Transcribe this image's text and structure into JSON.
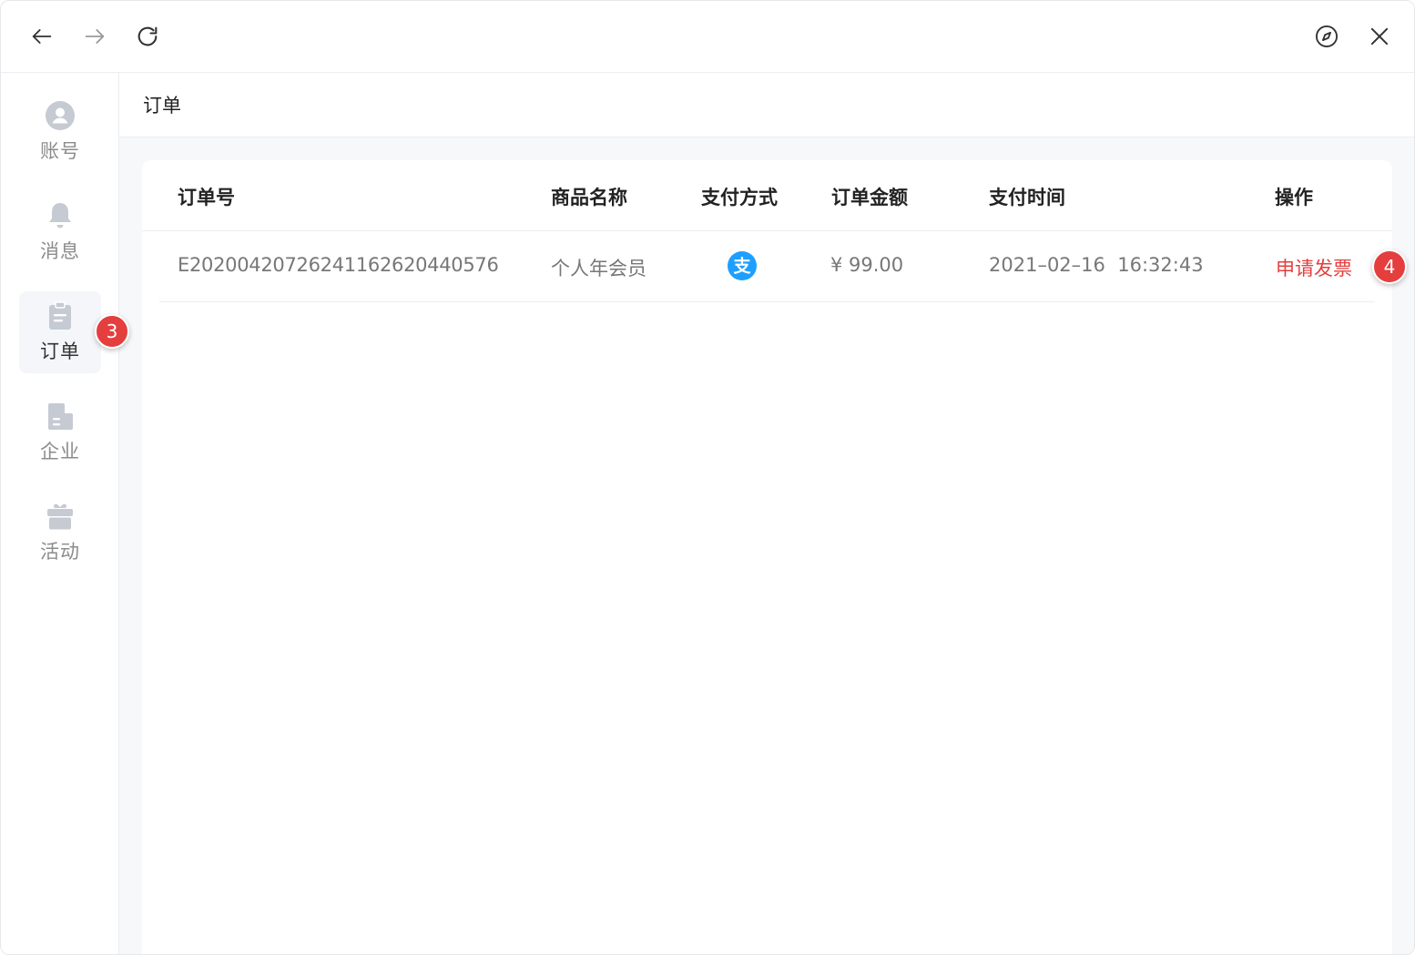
{
  "titlebar": {
    "icons": [
      "arrow-left-icon",
      "arrow-right-icon",
      "refresh-icon",
      "compass-icon",
      "close-icon"
    ]
  },
  "sidebar": {
    "items": [
      {
        "label": "账号",
        "icon": "user-icon"
      },
      {
        "label": "消息",
        "icon": "bell-icon"
      },
      {
        "label": "订单",
        "icon": "clipboard-icon"
      },
      {
        "label": "企业",
        "icon": "building-icon"
      },
      {
        "label": "活动",
        "icon": "gift-icon"
      }
    ]
  },
  "badges": {
    "orders": "3",
    "invoice": "4"
  },
  "page": {
    "title": "订单"
  },
  "table": {
    "headers": [
      "订单号",
      "商品名称",
      "支付方式",
      "订单金额",
      "支付时间",
      "操作"
    ],
    "rows": [
      {
        "order_no": "E20200420726241162620440576",
        "product": "个人年会员",
        "payment_icon": "alipay-icon",
        "payment_glyph": "支",
        "amount": "¥ 99.00",
        "paid_at": "2021–02–16  16:32:43",
        "action": "申请发票"
      }
    ]
  },
  "colors": {
    "accent_red": "#e53e3e",
    "alipay_blue": "#1e9fff",
    "icon_gray": "#c5cad3"
  }
}
